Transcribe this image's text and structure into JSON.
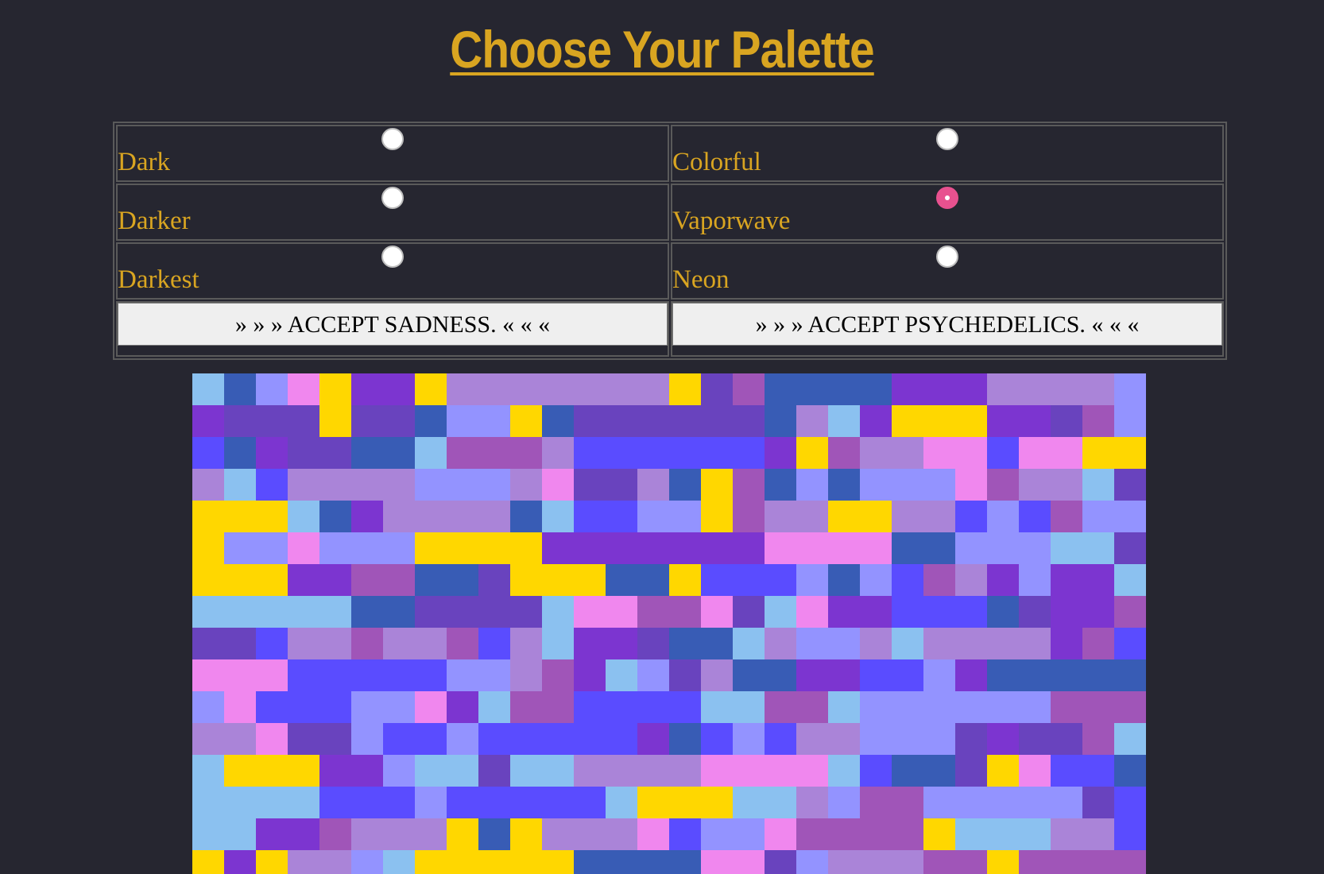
{
  "page": {
    "title": "Choose Your Palette"
  },
  "options": [
    {
      "label": "Dark",
      "checked": false
    },
    {
      "label": "Colorful",
      "checked": false
    },
    {
      "label": "Darker",
      "checked": false
    },
    {
      "label": "Vaporwave",
      "checked": true
    },
    {
      "label": "Darkest",
      "checked": false
    },
    {
      "label": "Neon",
      "checked": false
    }
  ],
  "buttons": {
    "sadness": "»   »   »      ACCEPT SADNESS.      «   «   «",
    "psychedelics": "»   »   »      ACCEPT PSYCHEDELICS.      «   «   «"
  },
  "colors": {
    "background": "#262630",
    "accent": "#d9a521",
    "radio_checked": "#e8518f",
    "mosaic_palette": [
      "#8bc1f0",
      "#ffd700",
      "#7c35d0",
      "#9393ff",
      "#a055b8",
      "#aa84d8",
      "#5a4cff",
      "#6943be",
      "#f087ee",
      "#385cb5"
    ]
  }
}
